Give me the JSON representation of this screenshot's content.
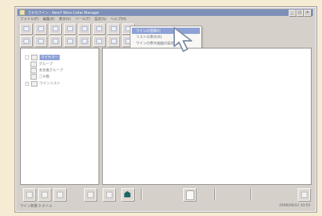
{
  "window": {
    "title": "さかなワイン - Nero? Wine Cellar Manager"
  },
  "menubar": {
    "items": [
      "ファイル(F)",
      "編集(E)",
      "表示(V)",
      "ツール(T)",
      "設定(S)",
      "ヘルプ(H)"
    ]
  },
  "dropdown": {
    "items": [
      "ワインの登録(I)",
      "リストの表示(R)",
      "ワインの表示画面の設定(D)"
    ]
  },
  "tree": {
    "items": [
      {
        "label": "マイセラー",
        "selected": true,
        "indent": 0
      },
      {
        "label": "グループ",
        "selected": false,
        "indent": 1
      },
      {
        "label": "未定義グループ",
        "selected": false,
        "indent": 1
      },
      {
        "label": "ごみ箱",
        "selected": false,
        "indent": 1
      },
      {
        "label": "ワインリスト",
        "selected": false,
        "indent": 0
      }
    ]
  },
  "status": {
    "left": "ワイン数量 0 ボトル",
    "right": "2008/09/12 10:53"
  },
  "icons": {
    "cursor": "pointer-arrow-icon",
    "teal_action": "house-icon",
    "hand_action": "hand-icon"
  },
  "colors": {
    "background": "#f6ecd3",
    "titlebar": "#7e90b8",
    "selection": "#8ea2d6",
    "accent": "#1c6767"
  }
}
